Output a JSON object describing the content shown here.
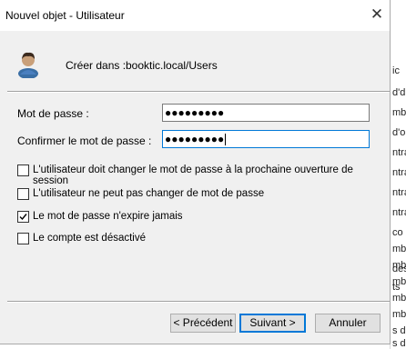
{
  "window": {
    "title": "Nouvel objet - Utilisateur",
    "close_glyph": "✕"
  },
  "header": {
    "create_in_label": "Créer dans :",
    "create_in_value": "booktic.local/Users",
    "icon": "user-icon"
  },
  "form": {
    "password_label": "Mot de passe :",
    "password_value": "●●●●●●●●●",
    "confirm_label": "Confirmer le mot de passe :",
    "confirm_value": "●●●●●●●●●"
  },
  "options": [
    {
      "label": "L'utilisateur doit changer le mot de passe à la prochaine ouverture de session",
      "checked": false
    },
    {
      "label": "L'utilisateur ne peut pas changer de mot de passe",
      "checked": false
    },
    {
      "label": "Le mot de passe n'expire jamais",
      "checked": true
    },
    {
      "label": "Le compte est désactivé",
      "checked": false
    }
  ],
  "buttons": {
    "back": "< Précédent",
    "next": "Suivant >",
    "cancel": "Annuler"
  },
  "background": {
    "fragments": [
      "ic",
      "d'd",
      "mbr",
      "d'o",
      "ntra",
      "ntra",
      "ntra",
      "ntra",
      "co",
      "mbr",
      "mbr",
      "mbr",
      "mbr",
      "des",
      "ts",
      "mbr",
      "s d",
      "s d"
    ]
  }
}
